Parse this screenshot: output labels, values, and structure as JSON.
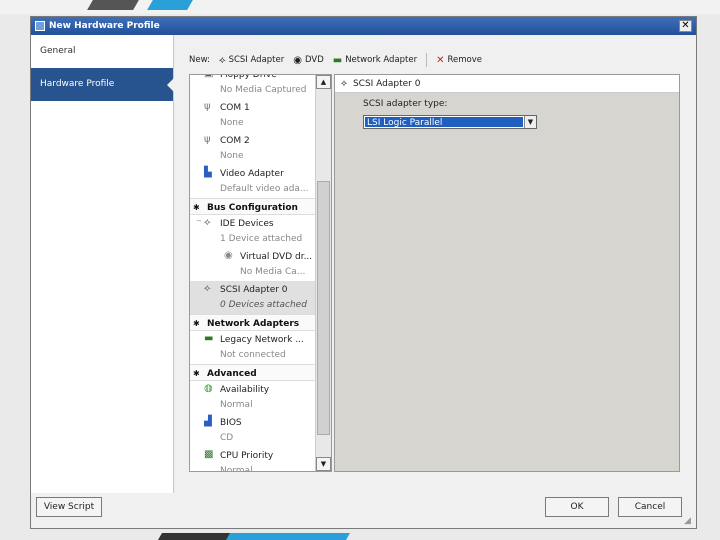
{
  "window": {
    "title": "New Hardware Profile",
    "close": "✕"
  },
  "nav": [
    {
      "label": "General"
    },
    {
      "label": "Hardware Profile"
    }
  ],
  "toolbar": {
    "new_label": "New:",
    "scsi_label": "SCSI Adapter",
    "dvd_label": "DVD",
    "network_label": "Network Adapter",
    "remove_label": "Remove"
  },
  "tree": {
    "floppy": {
      "name": "Floppy Drive",
      "status": "No Media Captured"
    },
    "com1": {
      "name": "COM 1",
      "status": "None"
    },
    "com2": {
      "name": "COM 2",
      "status": "None"
    },
    "video": {
      "name": "Video Adapter",
      "status": "Default video ada..."
    },
    "bus_config": "Bus Configuration",
    "ide": {
      "name": "IDE Devices",
      "status": "1 Device attached"
    },
    "dvd": {
      "name": "Virtual DVD dr...",
      "status": "No Media Ca..."
    },
    "scsi": {
      "name": "SCSI Adapter 0",
      "status": "0 Devices attached"
    },
    "network_adapters": "Network Adapters",
    "legacy": {
      "name": "Legacy Network ...",
      "status": "Not connected"
    },
    "advanced": "Advanced",
    "availability": {
      "name": "Availability",
      "status": "Normal"
    },
    "bios": {
      "name": "BIOS",
      "status": "CD"
    },
    "cpu": {
      "name": "CPU Priority",
      "status": "Normal"
    }
  },
  "panel": {
    "header": "SCSI Adapter 0",
    "field_label": "SCSI adapter type:",
    "field_value": "LSI Logic Parallel"
  },
  "buttons": {
    "view_script": "View Script",
    "ok": "OK",
    "cancel": "Cancel"
  }
}
